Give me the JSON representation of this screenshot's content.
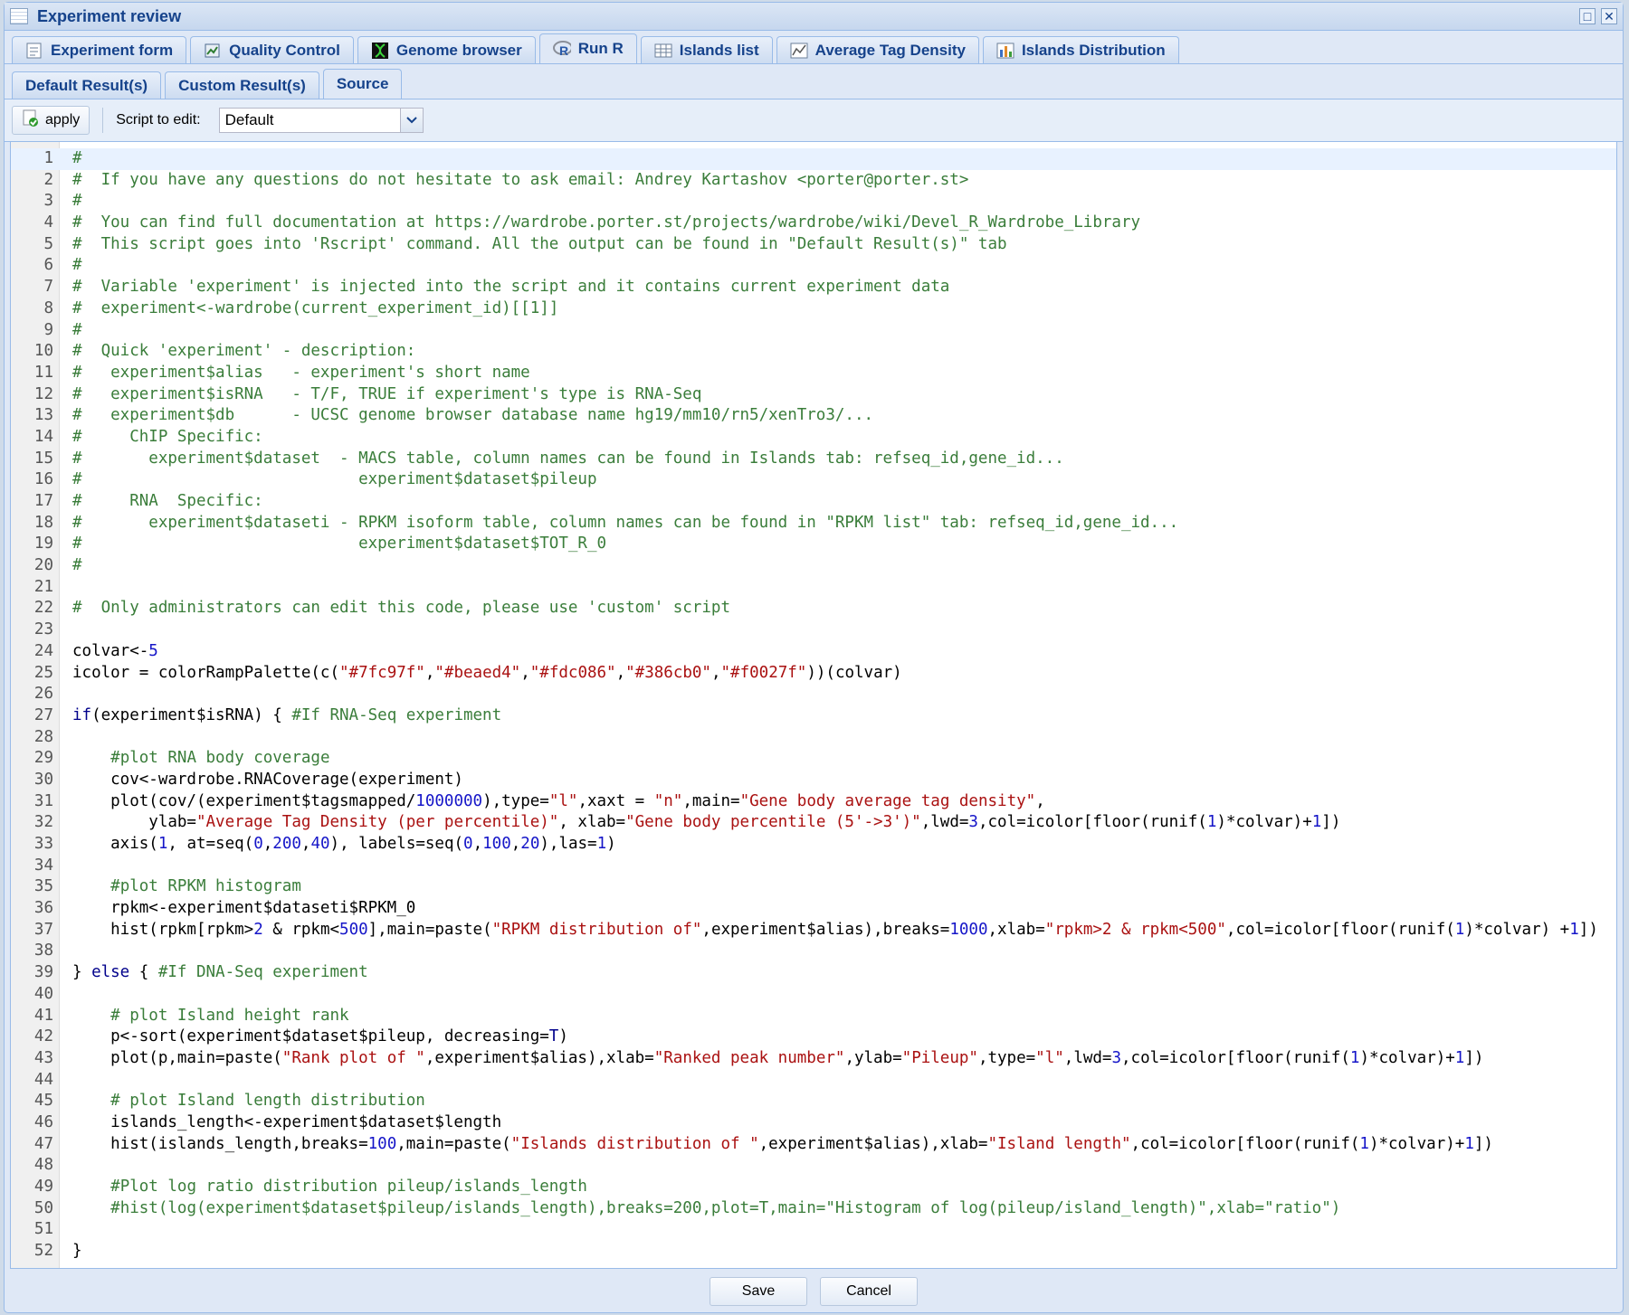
{
  "window": {
    "title": "Experiment review"
  },
  "tabs": [
    {
      "label": "Experiment form",
      "icon": "form-icon"
    },
    {
      "label": "Quality Control",
      "icon": "quality-icon"
    },
    {
      "label": "Genome browser",
      "icon": "dna-icon"
    },
    {
      "label": "Run R",
      "icon": "r-logo-icon",
      "active": true
    },
    {
      "label": "Islands list",
      "icon": "table-icon"
    },
    {
      "label": "Average Tag Density",
      "icon": "line-chart-icon"
    },
    {
      "label": "Islands Distribution",
      "icon": "bar-chart-icon"
    }
  ],
  "subtabs": [
    {
      "label": "Default Result(s)"
    },
    {
      "label": "Custom Result(s)"
    },
    {
      "label": "Source",
      "active": true
    }
  ],
  "toolbar": {
    "apply_label": "apply",
    "script_label": "Script to edit:",
    "script_value": "Default"
  },
  "footer": {
    "save_label": "Save",
    "cancel_label": "Cancel"
  },
  "colors": {
    "comment": "#3a7d3a",
    "string": "#a11111",
    "number": "#1515c8",
    "keyword": "#00008b",
    "header": "#15428b"
  },
  "code_lines": [
    "#",
    "#  If you have any questions do not hesitate to ask email: Andrey Kartashov <porter@porter.st>",
    "#",
    "#  You can find full documentation at https://wardrobe.porter.st/projects/wardrobe/wiki/Devel_R_Wardrobe_Library",
    "#  This script goes into 'Rscript' command. All the output can be found in \"Default Result(s)\" tab",
    "#",
    "#  Variable 'experiment' is injected into the script and it contains current experiment data",
    "#  experiment<-wardrobe(current_experiment_id)[[1]]",
    "#",
    "#  Quick 'experiment' - description:",
    "#   experiment$alias   - experiment's short name",
    "#   experiment$isRNA   - T/F, TRUE if experiment's type is RNA-Seq",
    "#   experiment$db      - UCSC genome browser database name hg19/mm10/rn5/xenTro3/...",
    "#     ChIP Specific:",
    "#       experiment$dataset  - MACS table, column names can be found in Islands tab: refseq_id,gene_id...",
    "#                             experiment$dataset$pileup",
    "#     RNA  Specific:",
    "#       experiment$dataseti - RPKM isoform table, column names can be found in \"RPKM list\" tab: refseq_id,gene_id...",
    "#                             experiment$dataset$TOT_R_0",
    "#",
    "",
    "#  Only administrators can edit this code, please use 'custom' script",
    "",
    "colvar<-5",
    "icolor = colorRampPalette(c(\"#7fc97f\",\"#beaed4\",\"#fdc086\",\"#386cb0\",\"#f0027f\"))(colvar)",
    "",
    "if(experiment$isRNA) { #If RNA-Seq experiment",
    "",
    "    #plot RNA body coverage",
    "    cov<-wardrobe.RNACoverage(experiment)",
    "    plot(cov/(experiment$tagsmapped/1000000),type=\"l\",xaxt = \"n\",main=\"Gene body average tag density\",",
    "        ylab=\"Average Tag Density (per percentile)\", xlab=\"Gene body percentile (5'->3')\",lwd=3,col=icolor[floor(runif(1)*colvar)+1])",
    "    axis(1, at=seq(0,200,40), labels=seq(0,100,20),las=1)",
    "",
    "    #plot RPKM histogram",
    "    rpkm<-experiment$dataseti$RPKM_0",
    "    hist(rpkm[rpkm>2 & rpkm<500],main=paste(\"RPKM distribution of\",experiment$alias),breaks=1000,xlab=\"rpkm>2 & rpkm<500\",col=icolor[floor(runif(1)*colvar) +1])",
    "",
    "} else { #If DNA-Seq experiment",
    "",
    "    # plot Island height rank",
    "    p<-sort(experiment$dataset$pileup, decreasing=T)",
    "    plot(p,main=paste(\"Rank plot of \",experiment$alias),xlab=\"Ranked peak number\",ylab=\"Pileup\",type=\"l\",lwd=3,col=icolor[floor(runif(1)*colvar)+1])",
    "",
    "    # plot Island length distribution",
    "    islands_length<-experiment$dataset$length",
    "    hist(islands_length,breaks=100,main=paste(\"Islands distribution of \",experiment$alias),xlab=\"Island length\",col=icolor[floor(runif(1)*colvar)+1])",
    "",
    "    #Plot log ratio distribution pileup/islands_length",
    "    #hist(log(experiment$dataset$pileup/islands_length),breaks=200,plot=T,main=\"Histogram of log(pileup/island_length)\",xlab=\"ratio\")",
    "",
    "}"
  ]
}
